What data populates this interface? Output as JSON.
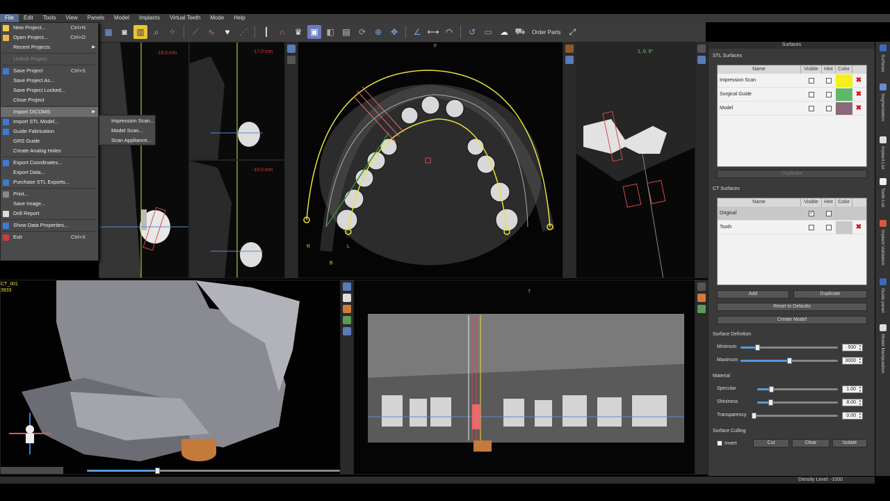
{
  "menubar": {
    "items": [
      "File",
      "Edit",
      "Tools",
      "View",
      "Panels",
      "Model",
      "Implants",
      "Virtual Teeth",
      "Mode",
      "Help"
    ]
  },
  "toolbar": {
    "order_parts_label": "Order Parts"
  },
  "file_menu": {
    "items": [
      {
        "label": "New Project...",
        "shortcut": "Ctrl+N",
        "icon_color": "#f2c94c"
      },
      {
        "label": "Open Project...",
        "shortcut": "Ctrl+O",
        "icon_color": "#e8b84a"
      },
      {
        "label": "Recent Projects",
        "submenu": true
      },
      {
        "label": "Unlock Project",
        "disabled": true
      },
      {
        "label": "Save Project",
        "shortcut": "Ctrl+S",
        "icon_color": "#3b7bd6"
      },
      {
        "label": "Save Project As..."
      },
      {
        "label": "Save Project Locked..."
      },
      {
        "label": "Close Project"
      },
      {
        "label": "Import DICOMS",
        "submenu": true,
        "hover": true
      },
      {
        "label": "Import STL Model...",
        "icon_color": "#3b7bd6"
      },
      {
        "label": "Guide Fabrication",
        "icon_color": "#3b7bd6"
      },
      {
        "label": "GRS Guide"
      },
      {
        "label": "Create Analog Holes"
      },
      {
        "label": "Export Coordinates...",
        "icon_color": "#3b7bd6"
      },
      {
        "label": "Export Data..."
      },
      {
        "label": "Purchase STL Exports...",
        "icon_color": "#3b7bd6"
      },
      {
        "label": "Print...",
        "icon_color": "#888888"
      },
      {
        "label": "Save Image..."
      },
      {
        "label": "Drill Report",
        "icon_color": "#dddddd"
      },
      {
        "label": "Show Data Properties...",
        "icon_color": "#3b7bd6"
      },
      {
        "label": "Exit",
        "shortcut": "Ctrl+X",
        "icon_color": "#d23a3a"
      }
    ],
    "import_submenu": [
      "Impression Scan...",
      "Model Scan...",
      "Scan Appliance..."
    ]
  },
  "viewports": {
    "slice1_label": "-18.0 mm",
    "slice2_label": "-17.0 mm",
    "slice3_label": "-16.0 mm",
    "axial_top_label": "F",
    "axial_left_label": "R",
    "axial_right_label": "L",
    "axial_bottom_label": "B",
    "sagittal_label": "1, 0, 0°",
    "ct_label_1": "CT_001",
    "ct_label_2": "3933",
    "pano_top_label": "T"
  },
  "surfaces_panel": {
    "title": "Surfaces",
    "stl_section": "STL Surfaces",
    "table_headers": [
      "Name",
      "Visible",
      "Hint",
      "Color"
    ],
    "stl_rows": [
      {
        "name": "Impression Scan",
        "color": "#f5ef1a",
        "visible": false,
        "hint": false
      },
      {
        "name": "Surgical Guide",
        "color": "#5fb86a",
        "visible": false,
        "hint": false
      },
      {
        "name": "Model",
        "color": "#8a6a78",
        "visible": false,
        "hint": false
      }
    ],
    "duplicate_label": "Duplicate",
    "ct_section": "CT Surfaces",
    "ct_rows": [
      {
        "name": "Original",
        "color": "#c8c8c8",
        "visible": true,
        "hint": false
      },
      {
        "name": "Tooth",
        "color": "#c8c8c8",
        "visible": false,
        "hint": false
      }
    ],
    "add_label": "Add",
    "duplicate2_label": "Duplicate",
    "reset_label": "Reset to Defaults",
    "create_model_label": "Create Model",
    "surface_definition": "Surface Definition",
    "minimum_label": "Minimum",
    "minimum_value": "500",
    "minimum_fraction": 0.17,
    "maximum_label": "Maximum",
    "maximum_value": "3000",
    "maximum_fraction": 0.5,
    "material_label": "Material",
    "specular_label": "Specular",
    "specular_value": "1.00",
    "specular_fraction": 0.17,
    "shininess_label": "Shininess",
    "shininess_value": "8.00",
    "shininess_fraction": 0.16,
    "transparency_label": "Transparency",
    "transparency_value": "0.00",
    "transparency_fraction": 0.0,
    "surface_culling": "Surface Culling",
    "invert_label": "Invert",
    "cut_label": "Cut",
    "clear_label": "Clear",
    "isolate_label": "Isolate"
  },
  "vtabs": [
    "Surfaces",
    "Segmentation",
    "Implant List",
    "Tooth List",
    "Implant Validation",
    "Guide panel",
    "Model Manipulation"
  ],
  "status": {
    "density": "Density Level: -1000"
  }
}
